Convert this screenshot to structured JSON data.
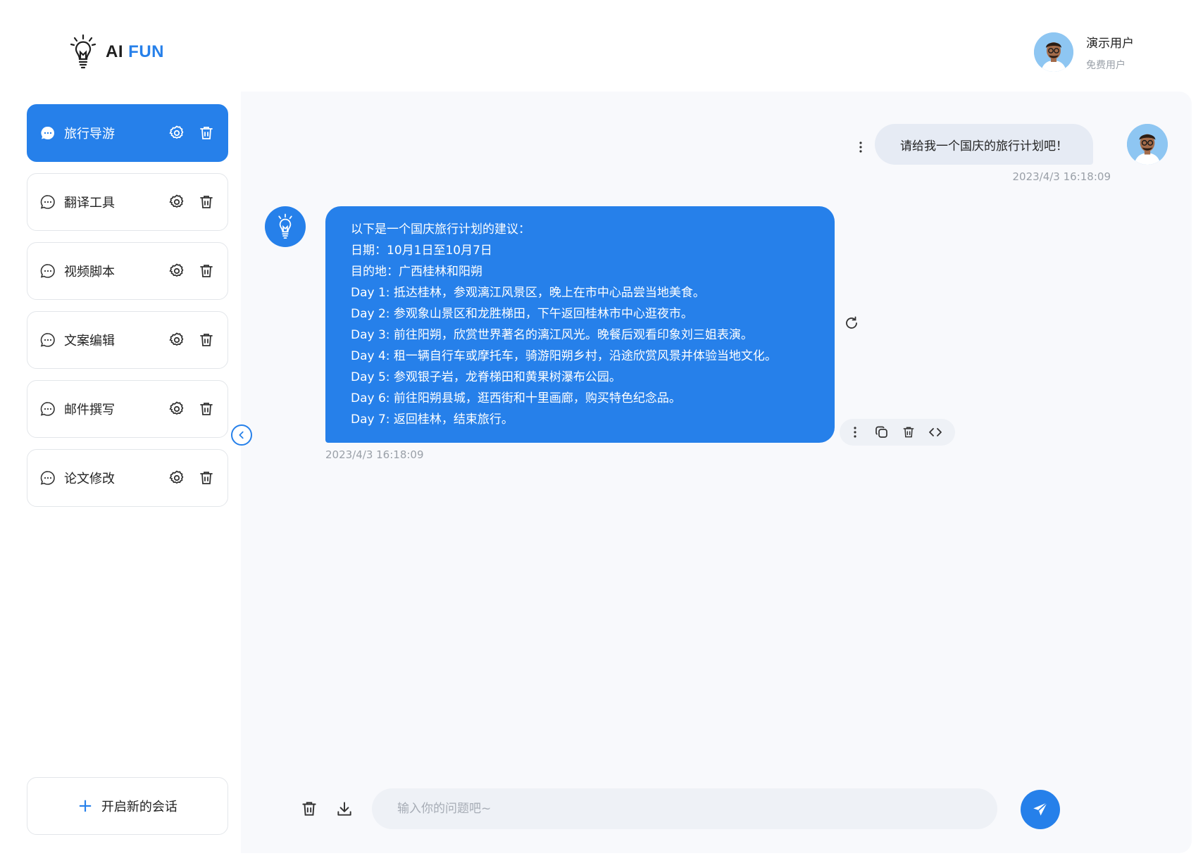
{
  "header": {
    "logo_ai": "AI",
    "logo_fun": "FUN",
    "user_name": "演示用户",
    "user_plan": "免费用户"
  },
  "sidebar": {
    "sessions": [
      {
        "label": "旅行导游",
        "active": true
      },
      {
        "label": "翻译工具",
        "active": false
      },
      {
        "label": "视频脚本",
        "active": false
      },
      {
        "label": "文案编辑",
        "active": false
      },
      {
        "label": "邮件撰写",
        "active": false
      },
      {
        "label": "论文修改",
        "active": false
      }
    ],
    "new_chat_label": "开启新的会话"
  },
  "chat": {
    "user_message": "请给我一个国庆的旅行计划吧！",
    "user_time": "2023/4/3 16:18:09",
    "bot_lines": [
      "以下是一个国庆旅行计划的建议：",
      "日期：10月1日至10月7日",
      "目的地：广西桂林和阳朔",
      "Day 1: 抵达桂林，参观漓江风景区，晚上在市中心品尝当地美食。",
      "Day 2: 参观象山景区和龙胜梯田，下午返回桂林市中心逛夜市。",
      "Day 3: 前往阳朔，欣赏世界著名的漓江风光。晚餐后观看印象刘三姐表演。",
      "Day 4: 租一辆自行车或摩托车，骑游阳朔乡村，沿途欣赏风景并体验当地文化。",
      "Day 5: 参观银子岩，龙脊梯田和黄果树瀑布公园。",
      "Day 6: 前往阳朔县城，逛西街和十里画廊，购买特色纪念品。",
      "Day 7: 返回桂林，结束旅行。"
    ],
    "bot_time": "2023/4/3 16:18:09"
  },
  "input": {
    "placeholder": "输入你的问题吧~"
  },
  "colors": {
    "accent": "#2680ea",
    "chat_bg": "#f8f9fc",
    "user_bubble": "#e6ebf4"
  }
}
